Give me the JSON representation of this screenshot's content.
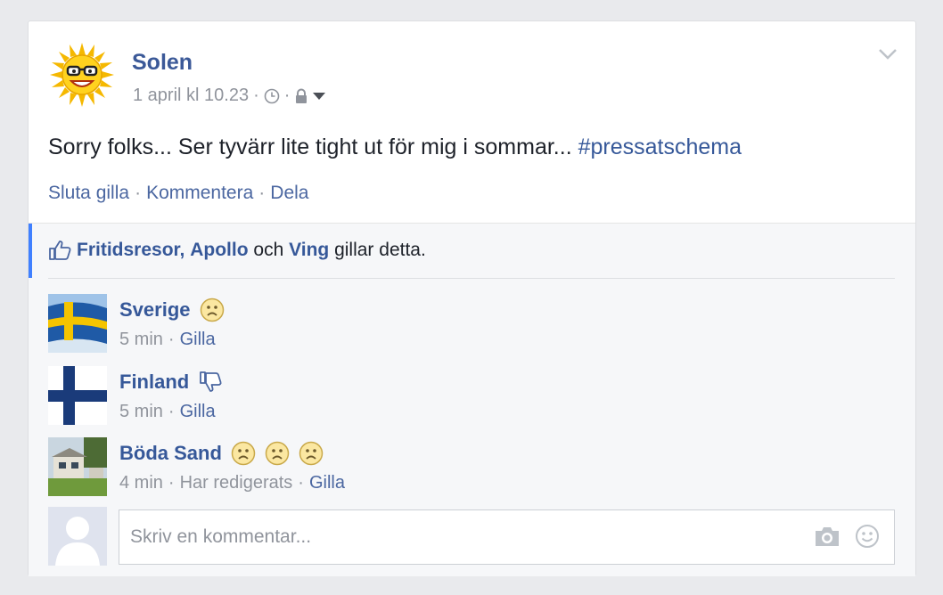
{
  "post": {
    "author": "Solen",
    "timestamp": "1 april kl 10.23",
    "text": "Sorry folks... Ser tyvärr lite tight ut för mig i sommar...",
    "hashtag": "#pressatschema",
    "actions": [
      "Sluta gilla",
      "Kommentera",
      "Dela"
    ]
  },
  "likes": {
    "names": [
      "Fritidsresor",
      "Apollo",
      "Ving"
    ],
    "comma": ",",
    "and": "och",
    "suffix": "gillar detta."
  },
  "comments": [
    {
      "name": "Sverige",
      "time": "5 min",
      "edited": "",
      "like_label": "Gilla",
      "icons": [
        "sad-face-icon"
      ]
    },
    {
      "name": "Finland",
      "time": "5 min",
      "edited": "",
      "like_label": "Gilla",
      "icons": [
        "thumbs-down-icon"
      ]
    },
    {
      "name": "Böda Sand",
      "time": "4 min",
      "edited": "Har redigerats",
      "like_label": "Gilla",
      "icons": [
        "sad-face-icon",
        "sad-face-icon",
        "sad-face-icon"
      ]
    }
  ],
  "composer": {
    "placeholder": "Skriv en kommentar..."
  },
  "colors": {
    "link": "#365899",
    "meta": "#90949c",
    "page_bg": "#e9eaed",
    "accent": "#4080ff"
  }
}
